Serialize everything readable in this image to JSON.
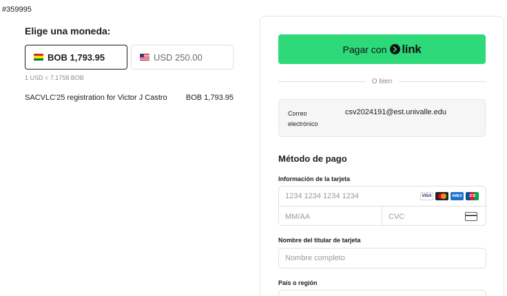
{
  "order_id": "#359995",
  "currency": {
    "title": "Elige una moneda:",
    "options": [
      {
        "label": "BOB 1,793.95",
        "flag": "bolivia-flag-icon",
        "selected": true
      },
      {
        "label": "USD 250.00",
        "flag": "us-flag-icon",
        "selected": false
      }
    ],
    "rate": "1 USD = 7.1758 BOB"
  },
  "line_item": {
    "description": "SACVLC'25 registration for Victor J Castro",
    "amount": "BOB 1,793.95"
  },
  "checkout": {
    "link_button_label": "Pagar con",
    "link_brand": "link",
    "divider_text": "O bien",
    "email_label": "Correo electrónico",
    "email_value": "csv2024191@est.univalle.edu",
    "payment_method_title": "Método de pago",
    "card_info_label": "Información de la tarjeta",
    "card_number_placeholder": "1234 1234 1234 1234",
    "card_brands": [
      "VISA",
      "mastercard",
      "AMEX",
      "JCB"
    ],
    "expiry_placeholder": "MM/AA",
    "cvc_placeholder": "CVC",
    "cardholder_label": "Nombre del titular de tarjeta",
    "cardholder_placeholder": "Nombre completo",
    "country_label": "País o región"
  },
  "colors": {
    "link_green": "#2ed97a",
    "selected_border": "#1a1a1a"
  }
}
